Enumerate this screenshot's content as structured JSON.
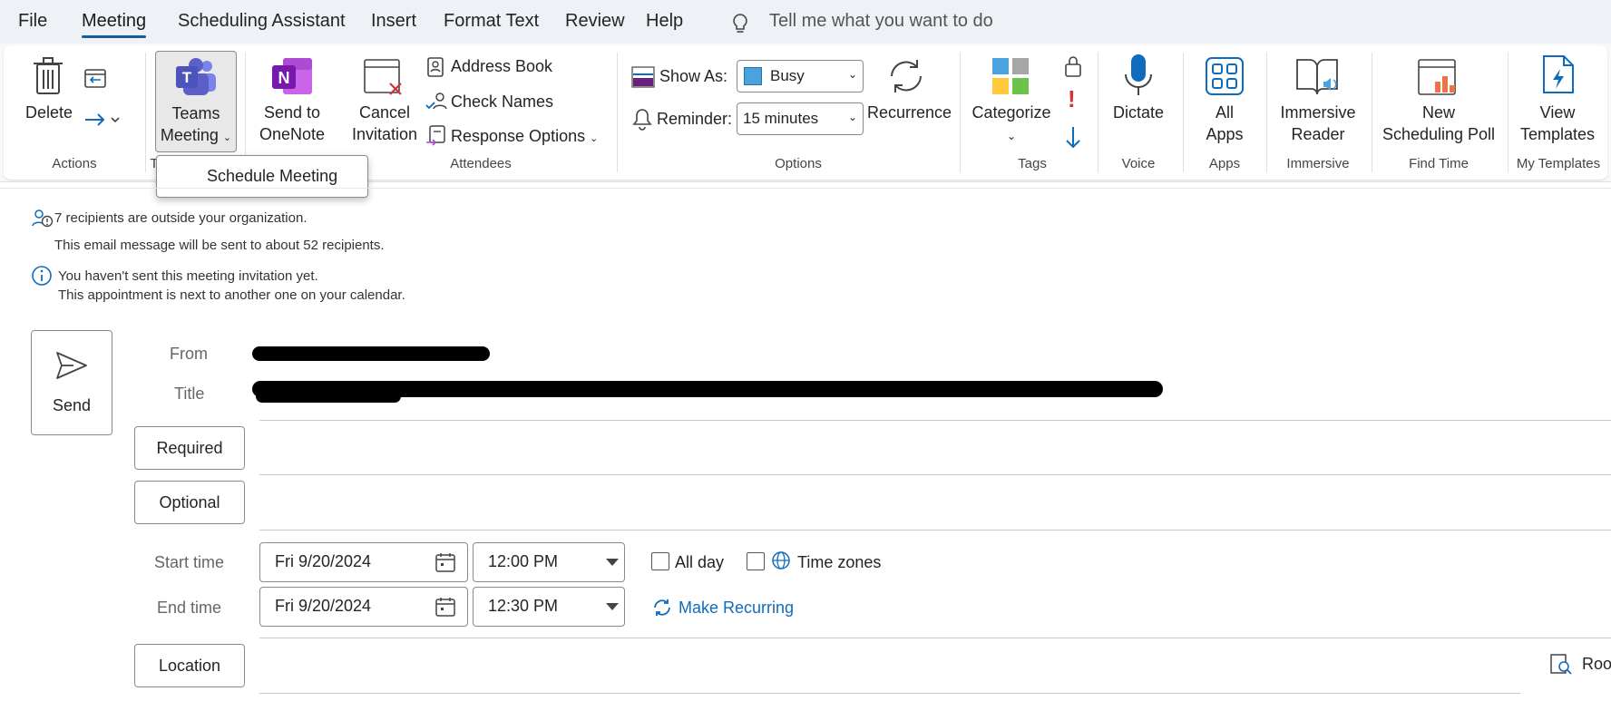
{
  "menu": {
    "tabs": [
      "File",
      "Meeting",
      "Scheduling Assistant",
      "Insert",
      "Format Text",
      "Review",
      "Help"
    ],
    "active": "Meeting",
    "tell_me": "Tell me what you want to do"
  },
  "ribbon": {
    "delete": "Delete",
    "teams_line1": "Teams",
    "teams_line2": "Meeting",
    "send_onenote_line1": "Send to",
    "send_onenote_line2": "OneNote",
    "cancel_line1": "Cancel",
    "cancel_line2": "Invitation",
    "address_book": "Address Book",
    "check_names": "Check Names",
    "response_options": "Response Options",
    "show_as_label": "Show As:",
    "show_as_value": "Busy",
    "reminder_label": "Reminder:",
    "reminder_value": "15 minutes",
    "recurrence": "Recurrence",
    "categorize": "Categorize",
    "dictate": "Dictate",
    "all_apps_line1": "All",
    "all_apps_line2": "Apps",
    "immersive_line1": "Immersive",
    "immersive_line2": "Reader",
    "poll_line1": "New",
    "poll_line2": "Scheduling Poll",
    "templates_line1": "View",
    "templates_line2": "Templates",
    "groups": {
      "actions": "Actions",
      "teams": "T",
      "attendees": "Attendees",
      "options": "Options",
      "tags": "Tags",
      "voice": "Voice",
      "apps": "Apps",
      "immersive": "Immersive",
      "find_time": "Find Time",
      "my_templates": "My Templates"
    }
  },
  "popup": {
    "schedule_meeting": "Schedule Meeting"
  },
  "info": {
    "outside_org": "7 recipients are outside your organization.",
    "recipients_count": "This email message will be sent to about 52 recipients.",
    "not_sent": "You haven't sent this meeting invitation yet.",
    "next_to_another": "This appointment is next to another one on your calendar."
  },
  "form": {
    "send": "Send",
    "from_label": "From",
    "title_label": "Title",
    "required": "Required",
    "optional": "Optional",
    "start_time_label": "Start time",
    "end_time_label": "End time",
    "start_date": "Fri 9/20/2024",
    "start_time": "12:00 PM",
    "end_date": "Fri 9/20/2024",
    "end_time": "12:30 PM",
    "all_day": "All day",
    "time_zones": "Time zones",
    "make_recurring": "Make Recurring",
    "location": "Location",
    "room_finder": "Roo"
  },
  "colors": {
    "accent": "#115ea3",
    "teams": "#5b5fc7",
    "onenote": "#7719aa",
    "link": "#0f6cbd",
    "important": "#d13438"
  }
}
